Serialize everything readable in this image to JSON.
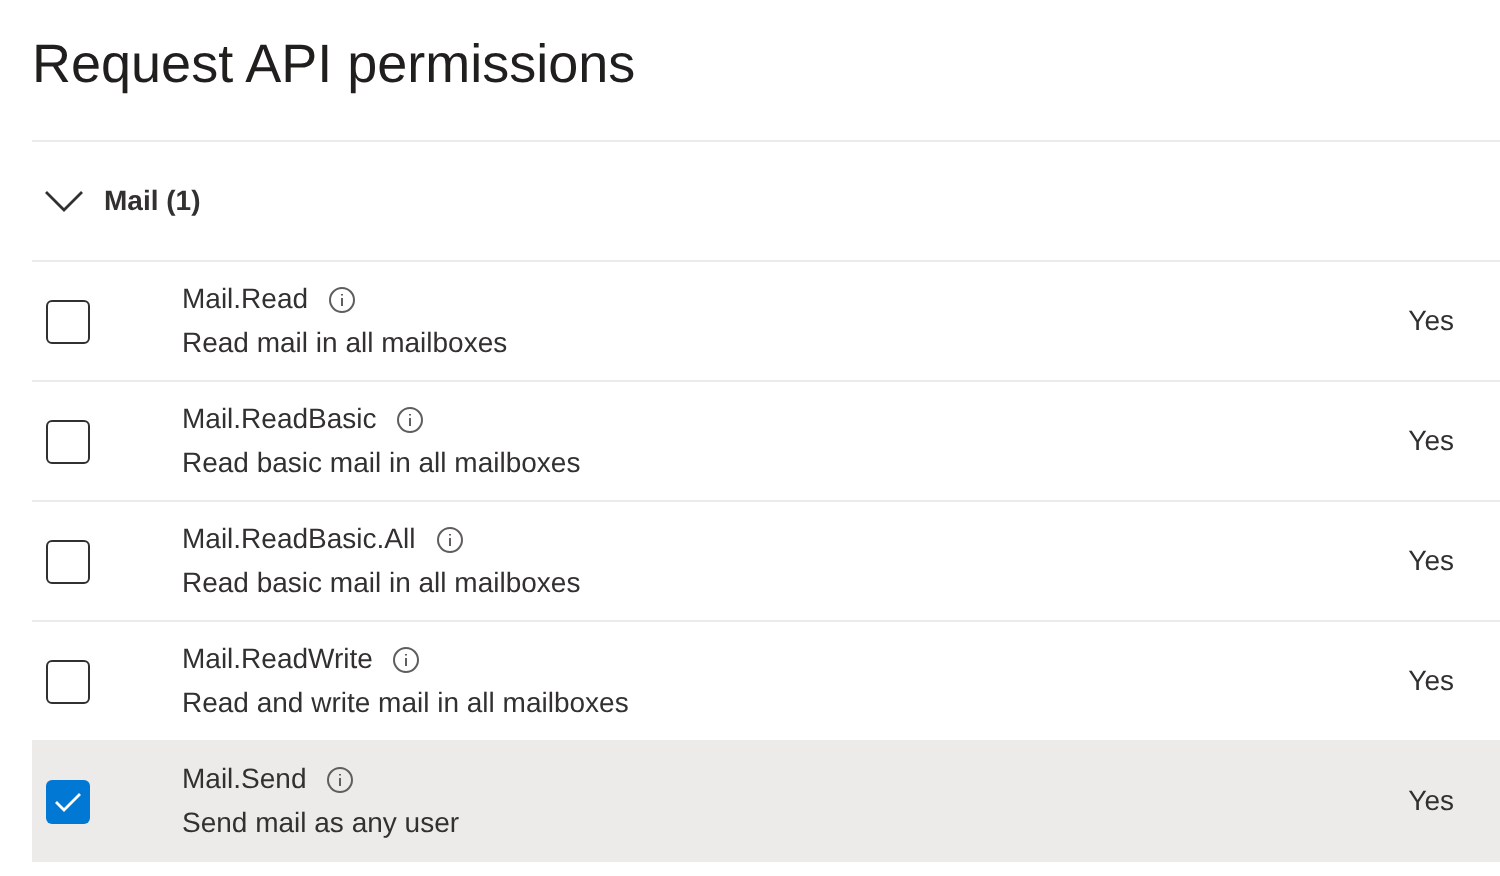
{
  "title": "Request API permissions",
  "group": {
    "label": "Mail (1)",
    "expanded": true
  },
  "permissions": [
    {
      "name": "Mail.Read",
      "description": "Read mail in all mailboxes",
      "admin_consent": "Yes",
      "checked": false
    },
    {
      "name": "Mail.ReadBasic",
      "description": "Read basic mail in all mailboxes",
      "admin_consent": "Yes",
      "checked": false
    },
    {
      "name": "Mail.ReadBasic.All",
      "description": "Read basic mail in all mailboxes",
      "admin_consent": "Yes",
      "checked": false
    },
    {
      "name": "Mail.ReadWrite",
      "description": "Read and write mail in all mailboxes",
      "admin_consent": "Yes",
      "checked": false
    },
    {
      "name": "Mail.Send",
      "description": "Send mail as any user",
      "admin_consent": "Yes",
      "checked": true
    }
  ]
}
